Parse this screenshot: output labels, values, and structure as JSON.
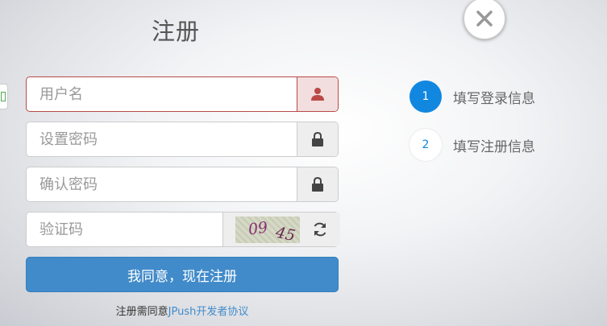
{
  "title": "注册",
  "form": {
    "username_placeholder": "用户名",
    "password_placeholder": "设置密码",
    "confirm_placeholder": "确认密码",
    "captcha_placeholder": "验证码",
    "captcha_text_1": "09",
    "captcha_text_2": "45",
    "submit_label": "我同意，现在注册"
  },
  "agreement": {
    "prefix": "注册需同意",
    "link": "JPush开发者协议"
  },
  "steps": [
    {
      "num": "1",
      "label": "填写登录信息",
      "active": true
    },
    {
      "num": "2",
      "label": "填写注册信息",
      "active": false
    }
  ],
  "icons": {
    "close": "close-icon",
    "user": "user-icon",
    "lock": "lock-icon",
    "refresh": "refresh-icon"
  },
  "colors": {
    "primary": "#428bca",
    "step_active": "#1187e0",
    "error": "#b94a48"
  }
}
